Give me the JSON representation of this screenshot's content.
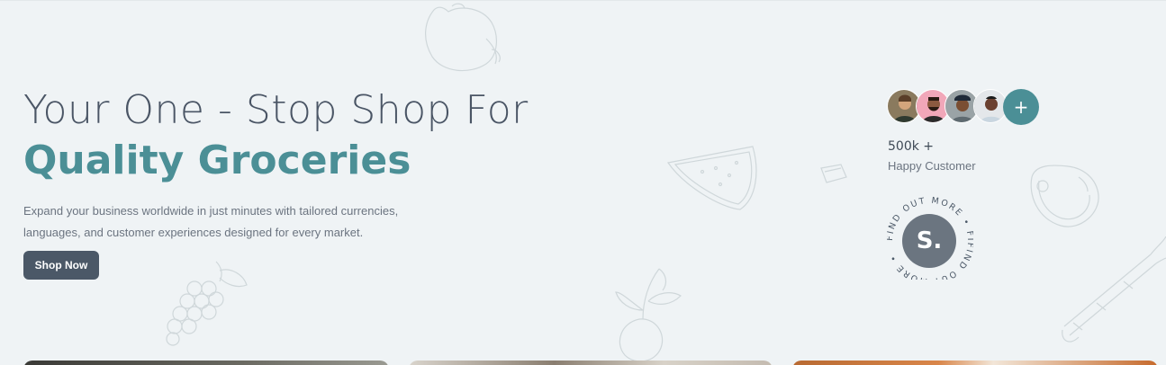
{
  "hero": {
    "title_line1": "Your One - Stop Shop For",
    "title_line2": "Quality Groceries",
    "description": "Expand your business worldwide in just minutes with tailored currencies, languages, and customer experiences designed for every market.",
    "cta_label": "Shop Now"
  },
  "customers": {
    "count": "500k +",
    "label": "Happy Customer",
    "more_button": "+",
    "avatars": [
      "avatar-1",
      "avatar-2",
      "avatar-3",
      "avatar-4"
    ]
  },
  "badge": {
    "ring_text": "FIND OUT MORE • FIFIND OUT MORE •",
    "center_letter": "S."
  },
  "colors": {
    "background": "#eff3f5",
    "accent": "#4b8f96",
    "dark": "#4b5867",
    "text": "#4a5565"
  }
}
